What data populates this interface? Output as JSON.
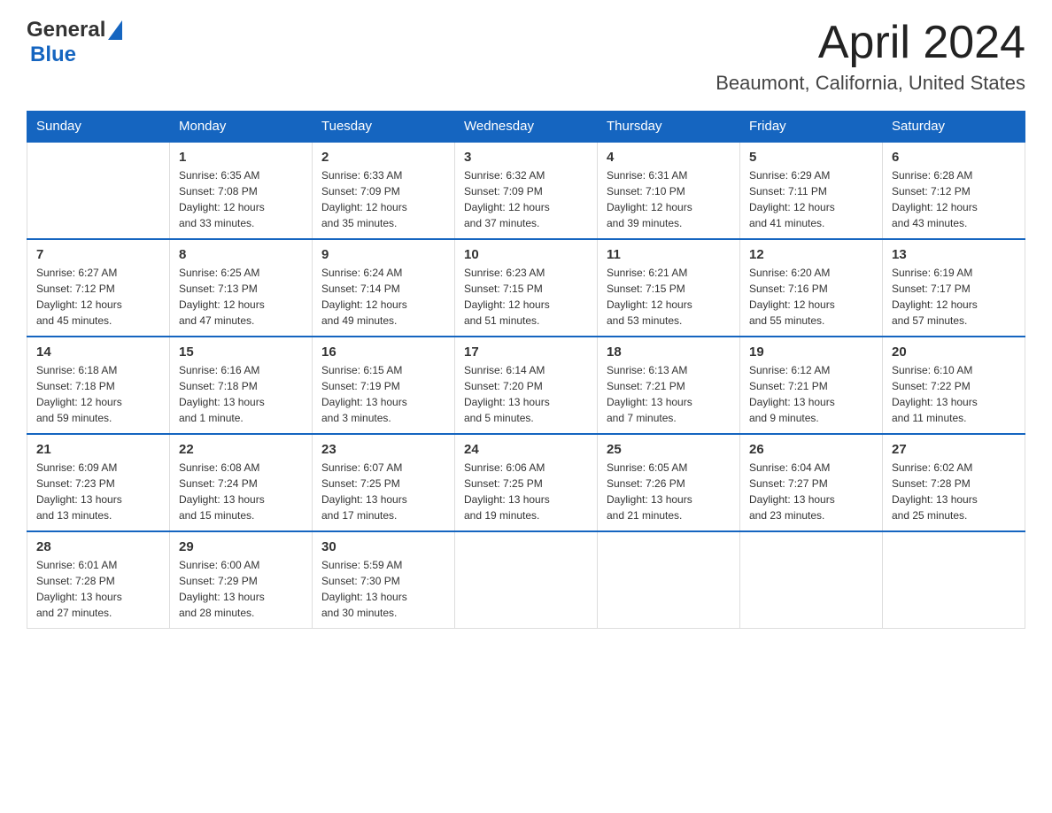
{
  "header": {
    "logo_general": "General",
    "logo_blue": "Blue",
    "title": "April 2024",
    "subtitle": "Beaumont, California, United States"
  },
  "weekdays": [
    "Sunday",
    "Monday",
    "Tuesday",
    "Wednesday",
    "Thursday",
    "Friday",
    "Saturday"
  ],
  "weeks": [
    [
      {
        "day": "",
        "info": ""
      },
      {
        "day": "1",
        "info": "Sunrise: 6:35 AM\nSunset: 7:08 PM\nDaylight: 12 hours\nand 33 minutes."
      },
      {
        "day": "2",
        "info": "Sunrise: 6:33 AM\nSunset: 7:09 PM\nDaylight: 12 hours\nand 35 minutes."
      },
      {
        "day": "3",
        "info": "Sunrise: 6:32 AM\nSunset: 7:09 PM\nDaylight: 12 hours\nand 37 minutes."
      },
      {
        "day": "4",
        "info": "Sunrise: 6:31 AM\nSunset: 7:10 PM\nDaylight: 12 hours\nand 39 minutes."
      },
      {
        "day": "5",
        "info": "Sunrise: 6:29 AM\nSunset: 7:11 PM\nDaylight: 12 hours\nand 41 minutes."
      },
      {
        "day": "6",
        "info": "Sunrise: 6:28 AM\nSunset: 7:12 PM\nDaylight: 12 hours\nand 43 minutes."
      }
    ],
    [
      {
        "day": "7",
        "info": "Sunrise: 6:27 AM\nSunset: 7:12 PM\nDaylight: 12 hours\nand 45 minutes."
      },
      {
        "day": "8",
        "info": "Sunrise: 6:25 AM\nSunset: 7:13 PM\nDaylight: 12 hours\nand 47 minutes."
      },
      {
        "day": "9",
        "info": "Sunrise: 6:24 AM\nSunset: 7:14 PM\nDaylight: 12 hours\nand 49 minutes."
      },
      {
        "day": "10",
        "info": "Sunrise: 6:23 AM\nSunset: 7:15 PM\nDaylight: 12 hours\nand 51 minutes."
      },
      {
        "day": "11",
        "info": "Sunrise: 6:21 AM\nSunset: 7:15 PM\nDaylight: 12 hours\nand 53 minutes."
      },
      {
        "day": "12",
        "info": "Sunrise: 6:20 AM\nSunset: 7:16 PM\nDaylight: 12 hours\nand 55 minutes."
      },
      {
        "day": "13",
        "info": "Sunrise: 6:19 AM\nSunset: 7:17 PM\nDaylight: 12 hours\nand 57 minutes."
      }
    ],
    [
      {
        "day": "14",
        "info": "Sunrise: 6:18 AM\nSunset: 7:18 PM\nDaylight: 12 hours\nand 59 minutes."
      },
      {
        "day": "15",
        "info": "Sunrise: 6:16 AM\nSunset: 7:18 PM\nDaylight: 13 hours\nand 1 minute."
      },
      {
        "day": "16",
        "info": "Sunrise: 6:15 AM\nSunset: 7:19 PM\nDaylight: 13 hours\nand 3 minutes."
      },
      {
        "day": "17",
        "info": "Sunrise: 6:14 AM\nSunset: 7:20 PM\nDaylight: 13 hours\nand 5 minutes."
      },
      {
        "day": "18",
        "info": "Sunrise: 6:13 AM\nSunset: 7:21 PM\nDaylight: 13 hours\nand 7 minutes."
      },
      {
        "day": "19",
        "info": "Sunrise: 6:12 AM\nSunset: 7:21 PM\nDaylight: 13 hours\nand 9 minutes."
      },
      {
        "day": "20",
        "info": "Sunrise: 6:10 AM\nSunset: 7:22 PM\nDaylight: 13 hours\nand 11 minutes."
      }
    ],
    [
      {
        "day": "21",
        "info": "Sunrise: 6:09 AM\nSunset: 7:23 PM\nDaylight: 13 hours\nand 13 minutes."
      },
      {
        "day": "22",
        "info": "Sunrise: 6:08 AM\nSunset: 7:24 PM\nDaylight: 13 hours\nand 15 minutes."
      },
      {
        "day": "23",
        "info": "Sunrise: 6:07 AM\nSunset: 7:25 PM\nDaylight: 13 hours\nand 17 minutes."
      },
      {
        "day": "24",
        "info": "Sunrise: 6:06 AM\nSunset: 7:25 PM\nDaylight: 13 hours\nand 19 minutes."
      },
      {
        "day": "25",
        "info": "Sunrise: 6:05 AM\nSunset: 7:26 PM\nDaylight: 13 hours\nand 21 minutes."
      },
      {
        "day": "26",
        "info": "Sunrise: 6:04 AM\nSunset: 7:27 PM\nDaylight: 13 hours\nand 23 minutes."
      },
      {
        "day": "27",
        "info": "Sunrise: 6:02 AM\nSunset: 7:28 PM\nDaylight: 13 hours\nand 25 minutes."
      }
    ],
    [
      {
        "day": "28",
        "info": "Sunrise: 6:01 AM\nSunset: 7:28 PM\nDaylight: 13 hours\nand 27 minutes."
      },
      {
        "day": "29",
        "info": "Sunrise: 6:00 AM\nSunset: 7:29 PM\nDaylight: 13 hours\nand 28 minutes."
      },
      {
        "day": "30",
        "info": "Sunrise: 5:59 AM\nSunset: 7:30 PM\nDaylight: 13 hours\nand 30 minutes."
      },
      {
        "day": "",
        "info": ""
      },
      {
        "day": "",
        "info": ""
      },
      {
        "day": "",
        "info": ""
      },
      {
        "day": "",
        "info": ""
      }
    ]
  ]
}
